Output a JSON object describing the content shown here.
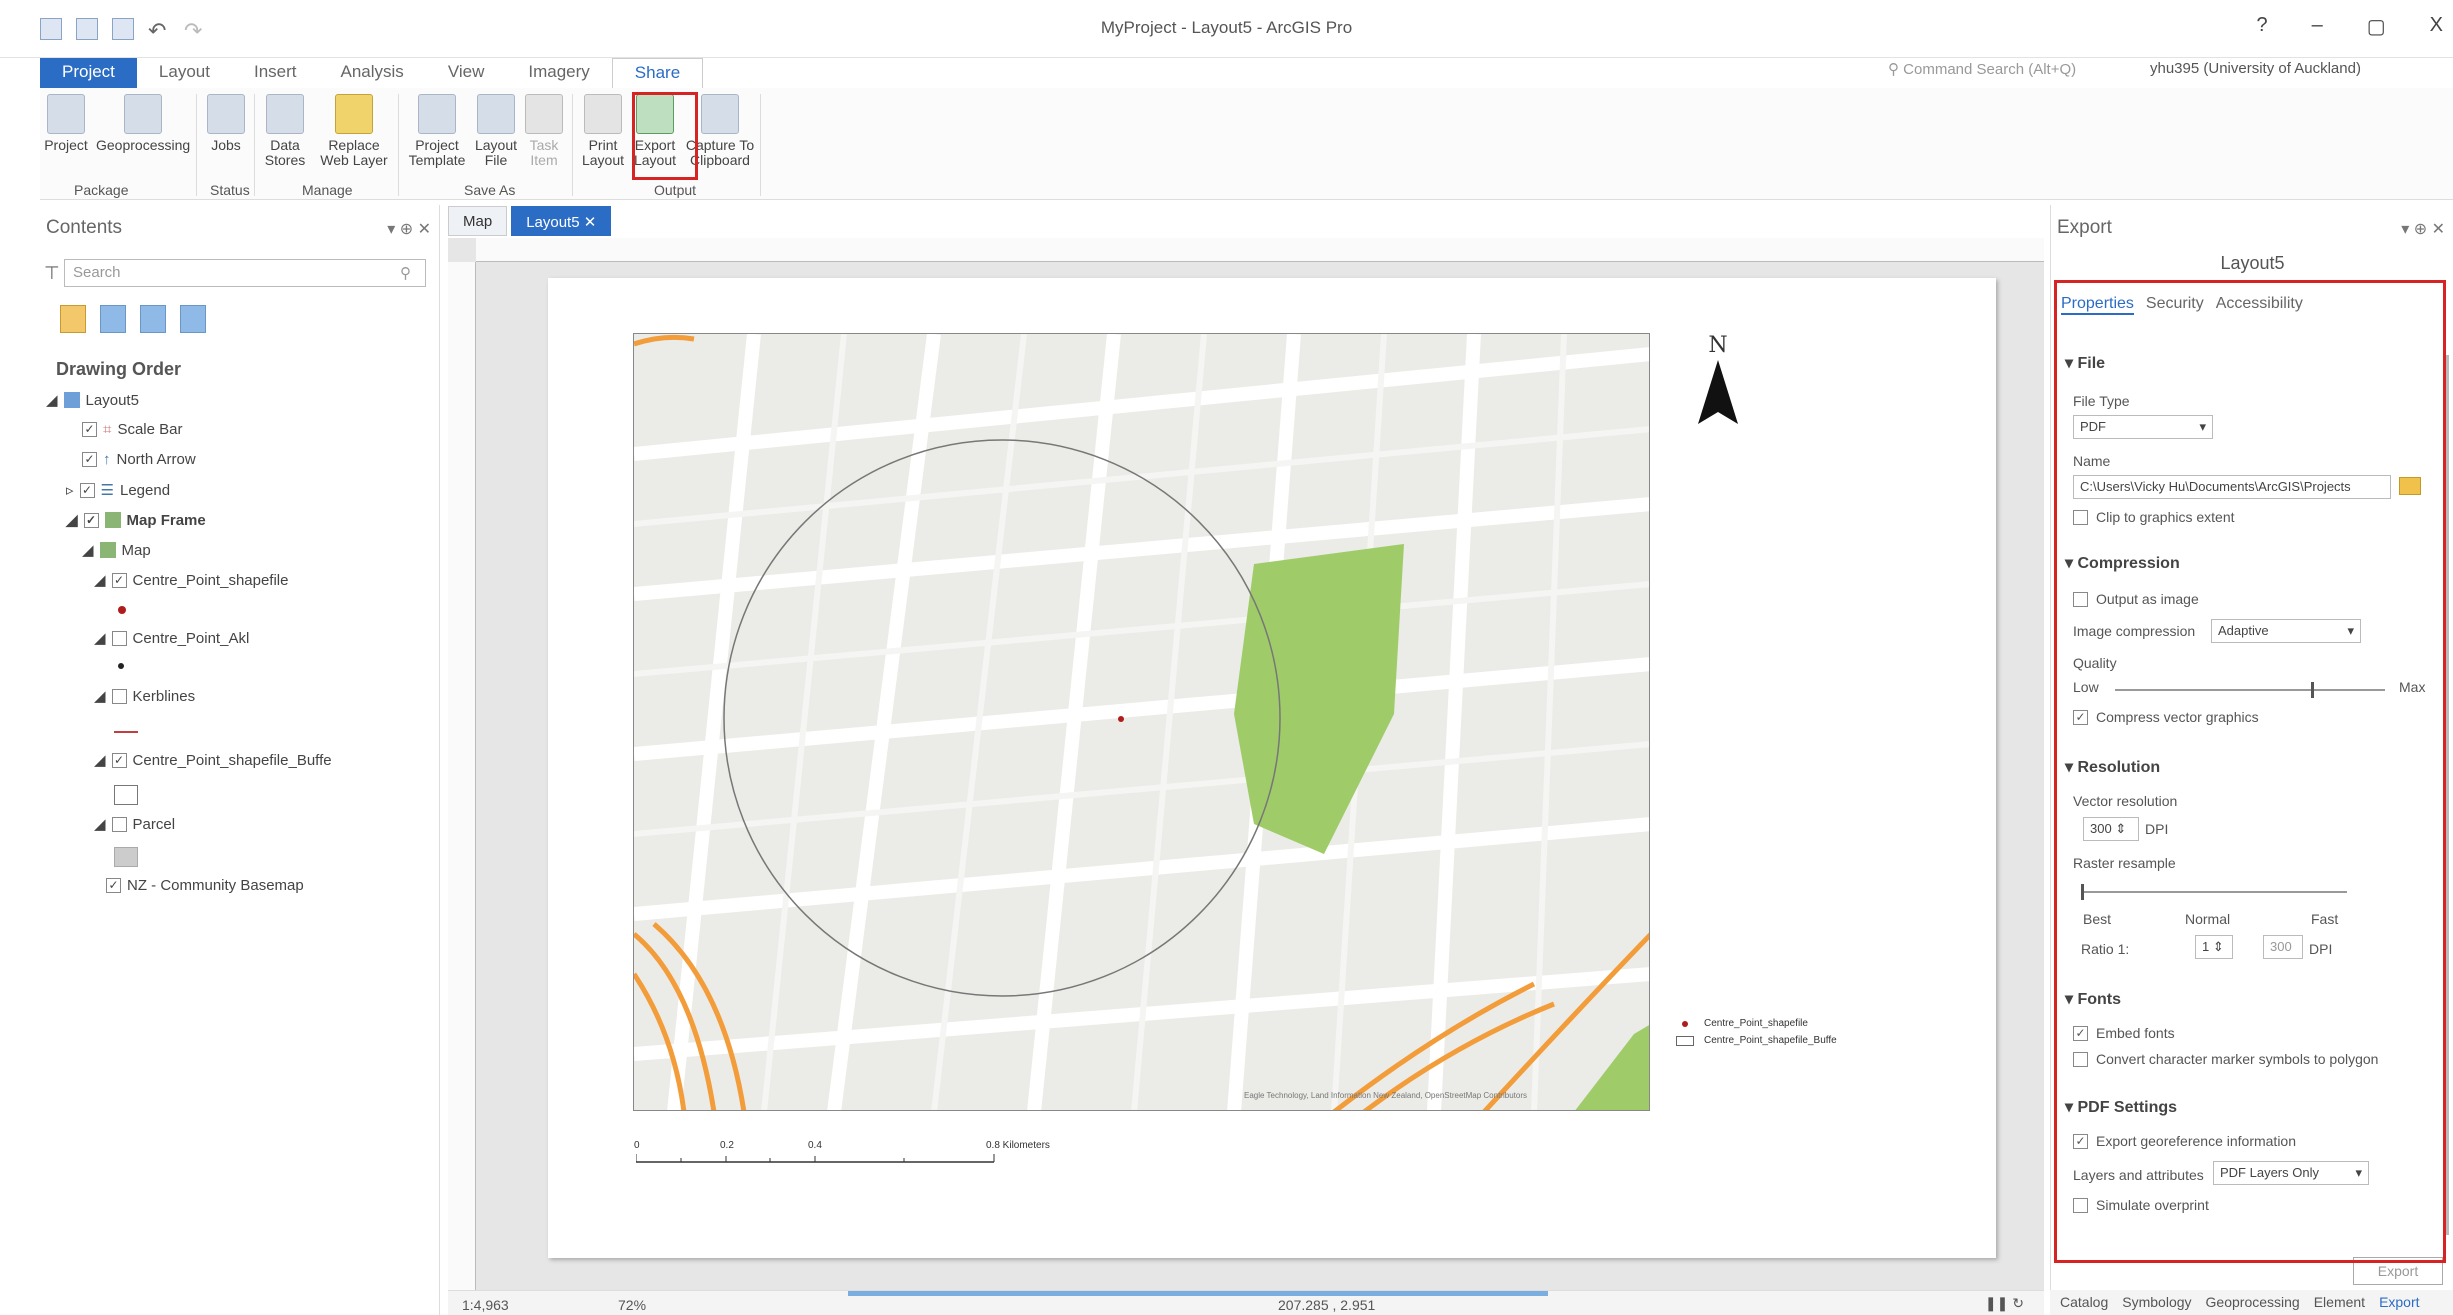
{
  "window": {
    "title": "MyProject - Layout5 - ArcGIS Pro",
    "controls": [
      "?",
      "–",
      "▢",
      "X"
    ]
  },
  "ribbon_tabs": [
    "Project",
    "Layout",
    "Insert",
    "Analysis",
    "View",
    "Imagery",
    "Share"
  ],
  "command_search": "Command Search (Alt+Q)",
  "user": "yhu395 (University of Auckland)",
  "ribbon": {
    "buttons": [
      {
        "label": "Project"
      },
      {
        "label": "Geoprocessing"
      },
      {
        "label": "Jobs"
      },
      {
        "label": "Data Stores"
      },
      {
        "label": "Replace Web Layer"
      },
      {
        "label": "Project Template"
      },
      {
        "label": "Layout File"
      },
      {
        "label": "Task Item"
      },
      {
        "label": "Print Layout"
      },
      {
        "label": "Export Layout"
      },
      {
        "label": "Capture To Clipboard"
      }
    ],
    "groups": [
      "Package",
      "Status",
      "Manage",
      "Save As",
      "Output"
    ]
  },
  "contents": {
    "title": "Contents",
    "controls": "▾ ⊕ ✕",
    "search_placeholder": "Search",
    "drawing_order": "Drawing Order",
    "items": [
      {
        "label": "Layout5"
      },
      {
        "label": "Scale Bar"
      },
      {
        "label": "North Arrow"
      },
      {
        "label": "Legend"
      },
      {
        "label": "Map Frame"
      },
      {
        "label": "Map"
      },
      {
        "label": "Centre_Point_shapefile"
      },
      {
        "label": "Centre_Point_Akl"
      },
      {
        "label": "Kerblines"
      },
      {
        "label": "Centre_Point_shapefile_Buffe"
      },
      {
        "label": "Parcel"
      },
      {
        "label": "NZ - Community Basemap"
      }
    ]
  },
  "view_tabs": [
    "Map",
    "Layout5 ✕"
  ],
  "layout": {
    "north_label": "N",
    "legend": [
      "Centre_Point_shapefile",
      "Centre_Point_shapefile_Buffe"
    ],
    "scale_labels": [
      "0",
      "0.2",
      "0.4",
      "0.8 Kilometers"
    ],
    "attribution": "Eagle Technology, Land Information New Zealand, OpenStreetMap Contributors"
  },
  "status": {
    "scale": "1:4,963",
    "zoom": "72%",
    "coordinates": "207.285 , 2.951"
  },
  "export": {
    "title": "Export",
    "controls": "▾ ⊕ ✕",
    "subtitle": "Layout5",
    "tabs": [
      "Properties",
      "Security",
      "Accessibility"
    ],
    "file_section": "File",
    "file_type_label": "File Type",
    "file_type": "PDF",
    "name_label": "Name",
    "name_value": "C:\\Users\\Vicky Hu\\Documents\\ArcGIS\\Projects",
    "clip_label": "Clip to graphics extent",
    "compression_section": "Compression",
    "output_as_image": "Output as image",
    "image_compression_label": "Image compression",
    "image_compression": "Adaptive",
    "quality_label": "Quality",
    "quality_low": "Low",
    "quality_max": "Max",
    "compress_vector": "Compress vector graphics",
    "resolution_section": "Resolution",
    "vector_resolution_label": "Vector resolution",
    "vector_resolution": "300",
    "dpi": "DPI",
    "raster_resample_label": "Raster resample",
    "best": "Best",
    "normal": "Normal",
    "fast": "Fast",
    "ratio_label": "Ratio 1:",
    "ratio_value": "1",
    "ratio_dpi": "300",
    "fonts_section": "Fonts",
    "embed_fonts": "Embed fonts",
    "convert_marker": "Convert character marker symbols to polygon",
    "pdf_section": "PDF Settings",
    "export_georef": "Export georeference information",
    "layers_attr_label": "Layers and attributes",
    "layers_attr": "PDF Layers Only",
    "simulate_overprint": "Simulate overprint",
    "export_button": "Export"
  },
  "bottom_tabs": [
    "Catalog",
    "Symbology",
    "Geoprocessing",
    "Element",
    "Export"
  ]
}
